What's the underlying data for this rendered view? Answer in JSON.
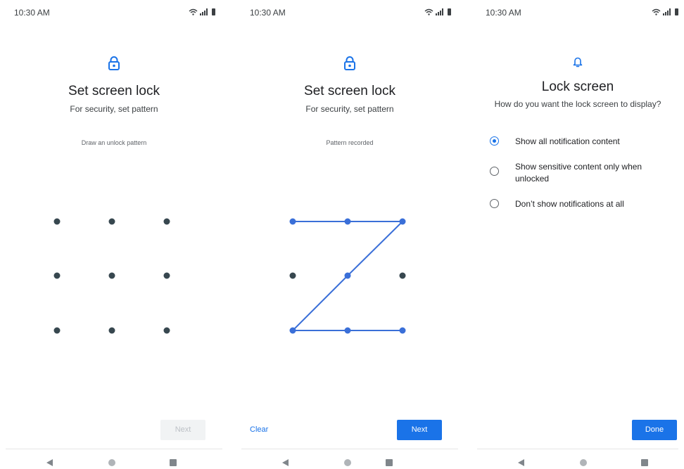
{
  "status_bar": {
    "time": "10:30 AM"
  },
  "screen1": {
    "title": "Set screen lock",
    "subtitle": "For security, set pattern",
    "hint": "Draw an unlock pattern",
    "next_label": "Next"
  },
  "screen2": {
    "title": "Set screen lock",
    "subtitle": "For security, set pattern",
    "hint": "Pattern recorded",
    "clear_label": "Clear",
    "next_label": "Next"
  },
  "screen3": {
    "title": "Lock screen",
    "subtitle": "How do you want the lock screen to display?",
    "options": [
      {
        "label": "Show all notification content",
        "selected": true
      },
      {
        "label": "Show sensitive content only when unlocked",
        "selected": false
      },
      {
        "label": "Don’t show notifications at all",
        "selected": false
      }
    ],
    "done_label": "Done"
  },
  "colors": {
    "accent": "#1a73e8",
    "dot": "#37474f",
    "pattern_line": "#3a6fd8"
  },
  "icons": {
    "lock": "lock-icon",
    "bell": "bell-icon",
    "back": "nav-back-icon",
    "home": "nav-home-icon",
    "recents": "nav-recents-icon"
  }
}
